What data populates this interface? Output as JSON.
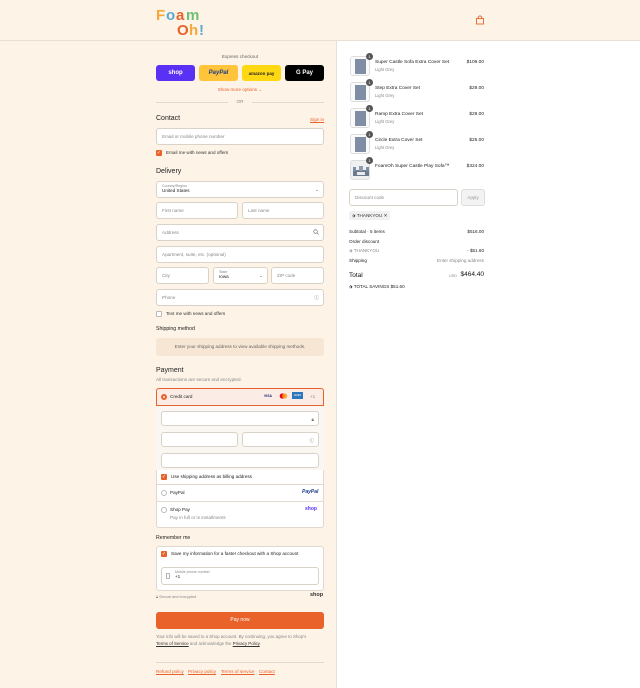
{
  "brand": {
    "logo_line1": "Foam",
    "logo_line2": "Oh!",
    "accent": "#e8622a",
    "bg": "#fdf3e7"
  },
  "express": {
    "title": "Express checkout",
    "buttons": [
      {
        "label": "shop",
        "color": "#5a31f4"
      },
      {
        "label": "PayPal",
        "color": "#ffc439"
      },
      {
        "label": "amazon pay",
        "color": "#ffd814"
      },
      {
        "label": "G Pay",
        "color": "#000000"
      }
    ],
    "show_more": "Show more options",
    "or": "OR"
  },
  "contact": {
    "heading": "Contact",
    "sign_in": "Sign in",
    "email_placeholder": "Email or mobile phone number",
    "news_label": "Email me with news and offers"
  },
  "delivery": {
    "heading": "Delivery",
    "country_label": "Country/Region",
    "country_value": "United States",
    "first_name": "First name",
    "last_name": "Last name",
    "address": "Address",
    "apartment": "Apartment, suite, etc. (optional)",
    "city": "City",
    "state_label": "State",
    "state_value": "Iowa",
    "zip": "ZIP code",
    "phone": "Phone",
    "text_label": "Text me with news and offers"
  },
  "shipping": {
    "heading": "Shipping method",
    "notice": "Enter your shipping address to view available shipping methods."
  },
  "payment": {
    "heading": "Payment",
    "subtitle": "All transactions are secure and encrypted.",
    "credit_card": "Credit card",
    "cards": [
      "VISA",
      "MC",
      "AMEX"
    ],
    "more_cards": "+1",
    "billing_label": "Use shipping address as billing address",
    "paypal": "PayPal",
    "paypal_logo": "PayPal",
    "shop_pay": "Shop Pay",
    "shop_pay_sub": "Pay in full or in installments",
    "shop_logo": "shop"
  },
  "remember": {
    "heading": "Remember me",
    "save_label": "Save my information for a faster checkout with a Shop account",
    "mobile_label": "Mobile phone number",
    "mobile_value": "+1",
    "secure": "Secure and encrypted",
    "shop": "shop"
  },
  "pay_now": "Pay now",
  "disclaimer": {
    "prefix": "Your info will be saved to a Shop account. By continuing, you agree to Shop's",
    "tos": "Terms of Service",
    "mid": " and acknowledge the ",
    "privacy": "Privacy Policy",
    "end": "."
  },
  "footer": [
    "Refund policy",
    "Privacy policy",
    "Terms of service",
    "Contact"
  ],
  "cart": {
    "items": [
      {
        "qty": "1",
        "name": "Super Castle Sofa Extra Cover Set",
        "variant": "Light Grey",
        "price": "$109.00"
      },
      {
        "qty": "1",
        "name": "Step Extra Cover Set",
        "variant": "Light Grey",
        "price": "$29.00"
      },
      {
        "qty": "1",
        "name": "Ramp Extra Cover Set",
        "variant": "Light Grey",
        "price": "$29.00"
      },
      {
        "qty": "1",
        "name": "Circle Extra Cover Set",
        "variant": "Light Grey",
        "price": "$25.00"
      },
      {
        "qty": "1",
        "name": "FoamOh Super Castle Play Sofa™",
        "variant": "",
        "price": "$324.00"
      }
    ],
    "discount_placeholder": "Discount code",
    "apply": "Apply",
    "code": "THANKYOU",
    "subtotal_label": "Subtotal · 5 items",
    "subtotal": "$516.00",
    "order_discount": "Order discount",
    "code_line": "THANKYOU",
    "discount_value": "- $51.60",
    "shipping_label": "Shipping",
    "shipping_value": "Enter shipping address",
    "total_label": "Total",
    "currency": "USD",
    "total": "$464.40",
    "savings_label": "TOTAL SAVINGS",
    "savings": "$51.60"
  }
}
